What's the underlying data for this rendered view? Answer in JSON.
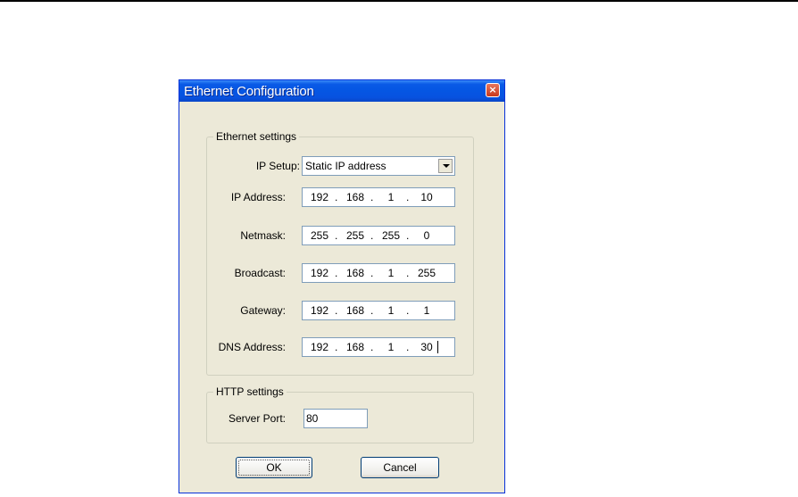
{
  "dialog": {
    "title": "Ethernet Configuration",
    "close_label": "×"
  },
  "ethernet": {
    "group_label": "Ethernet settings",
    "ip_setup": {
      "label": "IP Setup:",
      "value": "Static IP address"
    },
    "ip_address": {
      "label": "IP Address:",
      "octets": [
        "192",
        "168",
        "1",
        "10"
      ]
    },
    "netmask": {
      "label": "Netmask:",
      "octets": [
        "255",
        "255",
        "255",
        "0"
      ]
    },
    "broadcast": {
      "label": "Broadcast:",
      "octets": [
        "192",
        "168",
        "1",
        "255"
      ]
    },
    "gateway": {
      "label": "Gateway:",
      "octets": [
        "192",
        "168",
        "1",
        "1"
      ]
    },
    "dns": {
      "label": "DNS Address:",
      "octets": [
        "192",
        "168",
        "1",
        "30"
      ]
    }
  },
  "http": {
    "group_label": "HTTP settings",
    "server_port": {
      "label": "Server Port:",
      "value": "80"
    }
  },
  "buttons": {
    "ok": "OK",
    "cancel": "Cancel"
  },
  "separator": "."
}
